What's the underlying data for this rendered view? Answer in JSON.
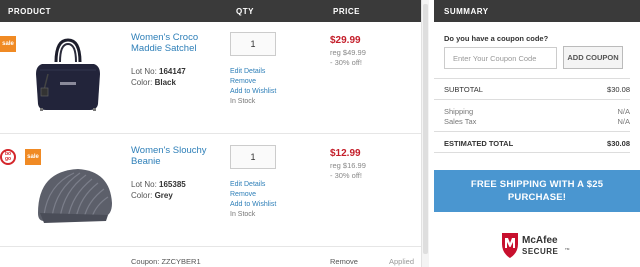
{
  "header": {
    "product": "PRODUCT",
    "qty": "QTY",
    "price": "PRICE",
    "summary": "SUMMARY"
  },
  "items": [
    {
      "name_line1": "Women's Croco",
      "name_line2": "Maddie Satchel",
      "lot_label": "Lot No:",
      "lot": "164147",
      "color_label": "Color:",
      "color": "Black",
      "qty": "1",
      "edit": "Edit Details",
      "remove": "Remove",
      "wishlist": "Add to Wishlist",
      "stock": "In Stock",
      "price": "$29.99",
      "reg": "reg $49.99",
      "discount": "- 30% off!",
      "badges": [
        "sale"
      ]
    },
    {
      "name_line1": "Women's Slouchy",
      "name_line2": "Beanie",
      "lot_label": "Lot No:",
      "lot": "165385",
      "color_label": "Color:",
      "color": "Grey",
      "qty": "1",
      "edit": "Edit Details",
      "remove": "Remove",
      "wishlist": "Add to Wishlist",
      "stock": "In Stock",
      "price": "$12.99",
      "reg": "reg $16.99",
      "discount": "- 30% off!",
      "badges": [
        "bogo",
        "sale"
      ]
    }
  ],
  "badges": {
    "sale": "sale",
    "bogo_line1": "bo",
    "bogo_line2": "go"
  },
  "coupon_row": {
    "code": "Coupon: ZZCYBER1",
    "remove": "Remove",
    "status": "Applied"
  },
  "summary": {
    "coupon_question": "Do you have a coupon code?",
    "coupon_placeholder": "Enter Your Coupon Code",
    "add_coupon": "ADD COUPON",
    "subtotal_label": "SUBTOTAL",
    "subtotal": "$30.08",
    "shipping_label": "Shipping",
    "shipping": "N/A",
    "tax_label": "Sales Tax",
    "tax": "N/A",
    "estimated_label": "ESTIMATED TOTAL",
    "estimated": "$30.08"
  },
  "promo": {
    "line1": "FREE SHIPPING WITH A $25",
    "line2": "PURCHASE!"
  },
  "mcafee": {
    "brand": "McAfee",
    "secure": "SECURE",
    "tm": "TM"
  },
  "colors": {
    "header_bg": "#3a3a3a",
    "link": "#2e7fb8",
    "price": "#c41e2a",
    "sale_badge": "#f08a24",
    "promo_bg": "#4a96d0",
    "mcafee_red": "#c8102e"
  },
  "icons": {
    "bag": "handbag-image",
    "beanie": "beanie-image",
    "mcafee": "mcafee-shield-icon"
  }
}
